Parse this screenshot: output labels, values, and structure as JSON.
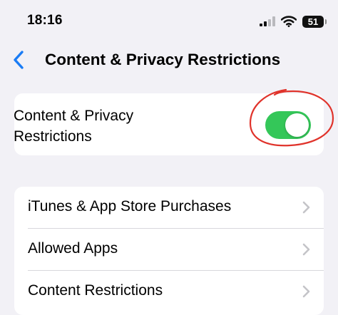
{
  "status_bar": {
    "time": "18:16",
    "battery_level": "51",
    "icons": [
      "signal-icon",
      "wifi-icon",
      "battery-icon"
    ]
  },
  "nav": {
    "title": "Content & Privacy Restrictions",
    "back_icon": "chevron-left-icon"
  },
  "toggle_row": {
    "label_line1": "Content & Privacy",
    "label_line2": "Restrictions",
    "enabled": true
  },
  "list": {
    "items": [
      {
        "label": "iTunes & App Store Purchases",
        "icon": "chevron-right-icon"
      },
      {
        "label": "Allowed Apps",
        "icon": "chevron-right-icon"
      },
      {
        "label": "Content Restrictions",
        "icon": "chevron-right-icon"
      }
    ]
  },
  "colors": {
    "background": "#f2f1f6",
    "accent_blue": "#1a7cf5",
    "toggle_on": "#34c759",
    "chevron": "#c4c4c8",
    "annotation_red": "#e0332b"
  }
}
